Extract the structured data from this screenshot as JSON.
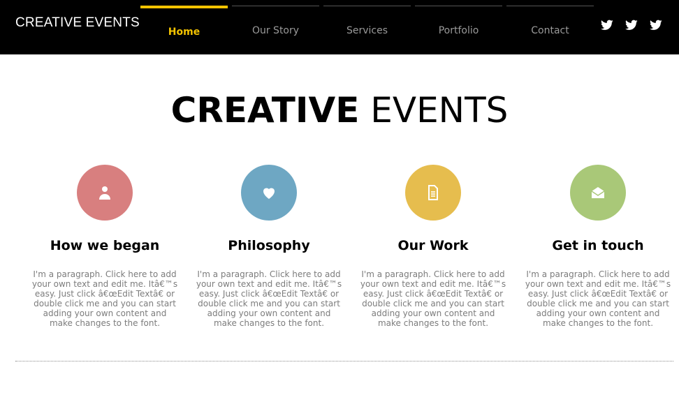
{
  "header": {
    "brand": "CREATIVE EVENTS",
    "nav": [
      {
        "label": "Home",
        "active": true
      },
      {
        "label": "Our Story",
        "active": false
      },
      {
        "label": "Services",
        "active": false
      },
      {
        "label": "Portfolio",
        "active": false
      },
      {
        "label": "Contact",
        "active": false
      }
    ],
    "socials": [
      {
        "icon": "twitter-icon"
      },
      {
        "icon": "twitter-icon"
      },
      {
        "icon": "twitter-icon"
      }
    ],
    "colors": {
      "background": "#000000",
      "active": "#f3c300",
      "inactive": "#9a9a9a"
    }
  },
  "hero": {
    "title_strong": "CREATIVE",
    "title_light": "EVENTS"
  },
  "cards": [
    {
      "icon": "user-icon",
      "color": "#d87f7f",
      "title": "How we began",
      "text": "I'm a paragraph. Click here to add your own text and edit me. Itâ€™s easy. Just click â€œEdit Textâ€ or double click me and you can start adding your own content and make changes to the font."
    },
    {
      "icon": "heart-icon",
      "color": "#6ea7c3",
      "title": "Philosophy",
      "text": "I'm a paragraph. Click here to add your own text and edit me. Itâ€™s easy. Just click â€œEdit Textâ€ or double click me and you can start adding your own content and make changes to the font."
    },
    {
      "icon": "document-icon",
      "color": "#e6bd4e",
      "title": "Our Work",
      "text": "I'm a paragraph. Click here to add your own text and edit me. Itâ€™s easy. Just click â€œEdit Textâ€ or double click me and you can start adding your own content and make changes to the font."
    },
    {
      "icon": "envelope-icon",
      "color": "#a9c878",
      "title": "Get in touch",
      "text": "I'm a paragraph. Click here to add your own text and edit me. Itâ€™s easy. Just click â€œEdit Textâ€ or double click me and you can start adding your own content and make changes to the font."
    }
  ]
}
